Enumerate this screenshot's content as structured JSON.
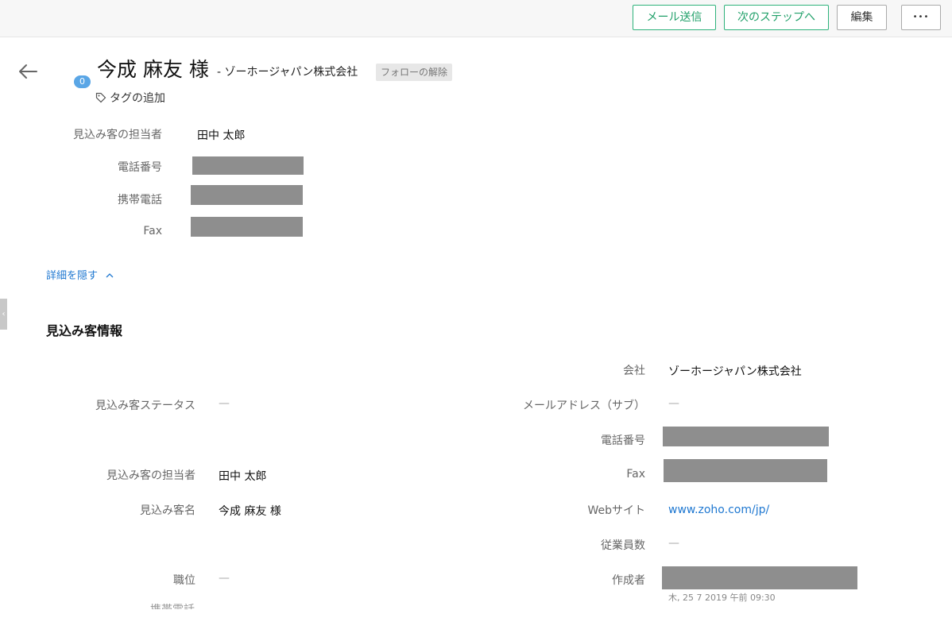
{
  "toolbar": {
    "email_label": "メール送信",
    "next_step_label": "次のステップへ",
    "edit_label": "編集",
    "more_label": "•••"
  },
  "header": {
    "badge_count": "0",
    "lead_name": "今成 麻友 様",
    "company_suffix": "- ゾーホージャパン株式会社",
    "follow_label": "フォローの解除",
    "tag_add_label": "タグの追加"
  },
  "summary": {
    "owner_label": "見込み客の担当者",
    "owner_value": "田中 太郎",
    "phone_label": "電話番号",
    "mobile_label": "携帯電話",
    "fax_label": "Fax",
    "hide_details_label": "詳細を隠す"
  },
  "section": {
    "title": "見込み客情報"
  },
  "info_left": {
    "status_label": "見込み客ステータス",
    "status_value": "—",
    "owner_label": "見込み客の担当者",
    "owner_value": "田中 太郎",
    "name_label": "見込み客名",
    "name_value": "今成 麻友 様",
    "title_label": "職位",
    "title_value": "—",
    "mobile_label": "携帯電話"
  },
  "info_right": {
    "company_label": "会社",
    "company_value": "ゾーホージャパン株式会社",
    "secondary_email_label": "メールアドレス（サブ）",
    "secondary_email_value": "—",
    "phone_label": "電話番号",
    "fax_label": "Fax",
    "website_label": "Webサイト",
    "website_value": "www.zoho.com/jp/",
    "employees_label": "従業員数",
    "employees_value": "—",
    "created_by_label": "作成者",
    "created_time": "木, 25 7 2019 午前 09:30"
  },
  "colors": {
    "accent_green": "#21a06a",
    "link_blue": "#1f78d1",
    "redaction_gray": "#8e8e8e",
    "badge_blue": "#5aa6e6"
  }
}
